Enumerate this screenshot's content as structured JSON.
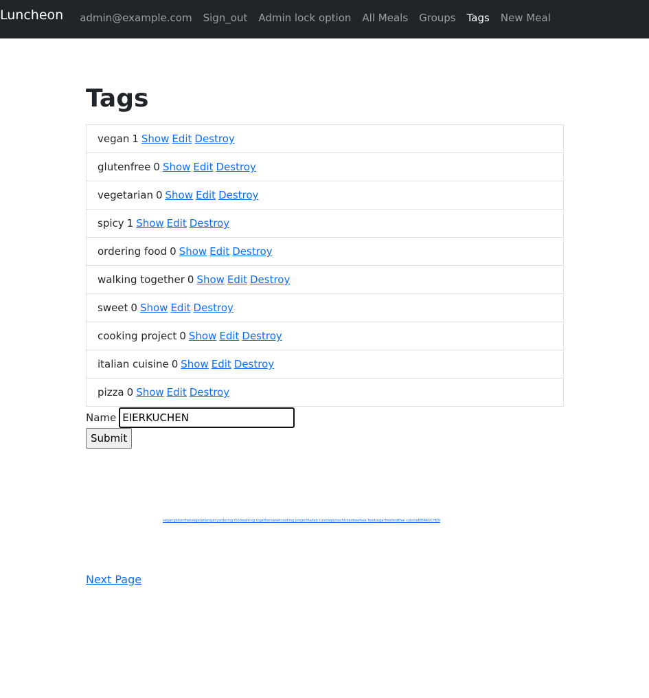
{
  "navbar": {
    "brand": "Luncheon",
    "links": [
      {
        "label": "admin@example.com"
      },
      {
        "label": "Sign_out"
      },
      {
        "label": "Admin lock option"
      },
      {
        "label": "All Meals"
      },
      {
        "label": "Groups"
      },
      {
        "label": "Tags"
      },
      {
        "label": "New Meal"
      }
    ]
  },
  "page": {
    "title": "Tags"
  },
  "tags": [
    {
      "name": "vegan",
      "count": "1",
      "show": "Show",
      "edit": "Edit",
      "destroy": "Destroy"
    },
    {
      "name": "glutenfree",
      "count": "0",
      "show": "Show",
      "edit": "Edit",
      "destroy": "Destroy"
    },
    {
      "name": "vegetarian",
      "count": "0",
      "show": "Show",
      "edit": "Edit",
      "destroy": "Destroy"
    },
    {
      "name": "spicy",
      "count": "1",
      "show": "Show",
      "edit": "Edit",
      "destroy": "Destroy"
    },
    {
      "name": "ordering food",
      "count": "0",
      "show": "Show",
      "edit": "Edit",
      "destroy": "Destroy"
    },
    {
      "name": "walking together",
      "count": "0",
      "show": "Show",
      "edit": "Edit",
      "destroy": "Destroy"
    },
    {
      "name": "sweet",
      "count": "0",
      "show": "Show",
      "edit": "Edit",
      "destroy": "Destroy"
    },
    {
      "name": "cooking project",
      "count": "0",
      "show": "Show",
      "edit": "Edit",
      "destroy": "Destroy"
    },
    {
      "name": "italian cuisine",
      "count": "0",
      "show": "Show",
      "edit": "Edit",
      "destroy": "Destroy"
    },
    {
      "name": "pizza",
      "count": "0",
      "show": "Show",
      "edit": "Edit",
      "destroy": "Destroy"
    }
  ],
  "form": {
    "name_label": "Name",
    "name_value": "EIERKUCHEN",
    "submit_label": "Submit"
  },
  "tag_cloud": [
    "vegan",
    "glutenfree",
    "vegetarian",
    "spicy",
    "ordering food",
    "walking together",
    "sweet",
    "cooking project",
    "italian cuisine",
    "pizza",
    "chicken",
    "beef",
    "sea food",
    "sugarfree",
    "test",
    "thai cuisine",
    "EIERKUCHEN"
  ],
  "pagination": {
    "next_label": "Next Page"
  },
  "colors": {
    "navbar_bg": "#212529",
    "link": "#0d6efd"
  }
}
